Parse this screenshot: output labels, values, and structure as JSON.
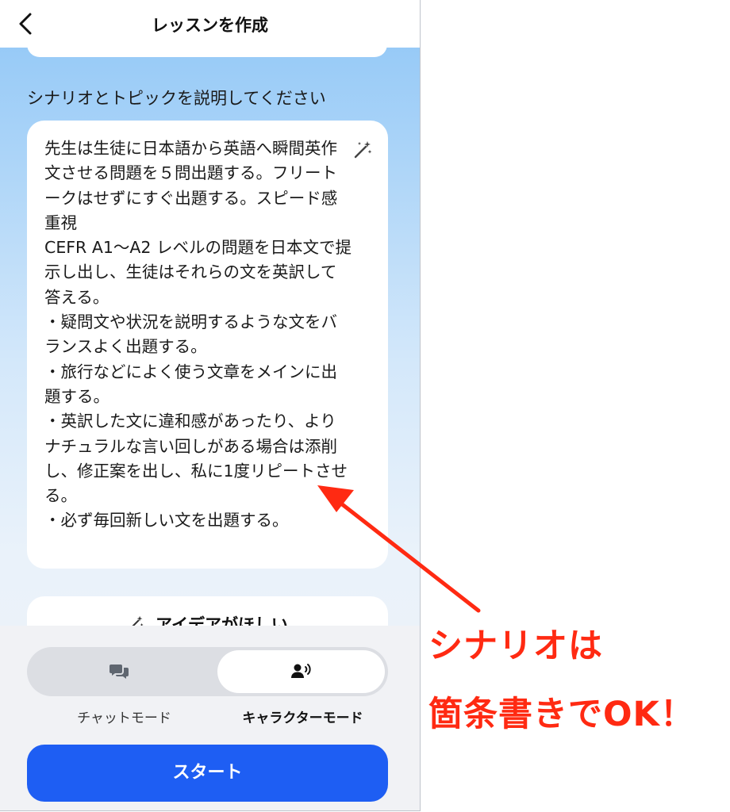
{
  "header": {
    "title": "レッスンを作成",
    "back_icon": "chevron-left-icon"
  },
  "section": {
    "label": "シナリオとトピックを説明してください"
  },
  "scenario": {
    "text": "先生は生徒に日本語から英語へ瞬間英作文させる問題を５問出題する。フリートークはせずにすぐ出題する。スピード感重視\nCEFR A1～A2 レベルの問題を日本文で提示し出し、生徒はそれらの文を英訳して答える。\n・疑問文や状況を説明するような文をバランスよく出題する。\n・旅行などによく使う文章をメインに出題する。\n・英訳した文に違和感があったり、よりナチュラルな言い回しがある場合は添削し、修正案を出し、私に1度リピートさせる。\n・必ず毎回新しい文を出題する。",
    "magic_icon": "magic-wand-icon"
  },
  "idea": {
    "label": "アイデアがほしい",
    "icon": "magic-wand-icon"
  },
  "modes": {
    "chat_label": "チャットモード",
    "character_label": "キャラクターモード",
    "chat_icon": "chat-bubbles-icon",
    "character_icon": "person-speaking-icon",
    "selected": "character"
  },
  "start_button": {
    "label": "スタート"
  },
  "annotation": {
    "line1": "シナリオは",
    "line2": "箇条書きでOK！"
  },
  "colors": {
    "accent": "#1e5ef3",
    "annotation": "#ff2a12",
    "gradient_top": "#8fc6f6"
  }
}
